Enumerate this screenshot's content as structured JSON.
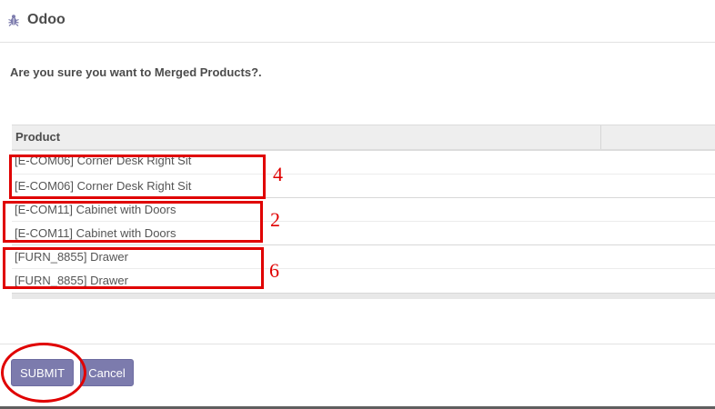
{
  "app": {
    "title": "Odoo"
  },
  "dialog": {
    "question": "Are you sure you want to Merged Products?."
  },
  "table": {
    "column_header": "Product",
    "rows": [
      "[E-COM06] Corner Desk Right Sit",
      "[E-COM06] Corner Desk Right Sit",
      "[E-COM11] Cabinet with Doors",
      "[E-COM11] Cabinet with Doors",
      "[FURN_8855] Drawer",
      "[FURN_8855] Drawer"
    ]
  },
  "annotations": {
    "group_1": "4",
    "group_2": "2",
    "group_3": "6"
  },
  "buttons": {
    "submit": "SUBMIT",
    "cancel": "Cancel"
  },
  "colors": {
    "button": "#7c7bad",
    "annotation": "#e00000",
    "text": "#4c4c4c"
  },
  "icons": {
    "app": "bug-icon"
  }
}
